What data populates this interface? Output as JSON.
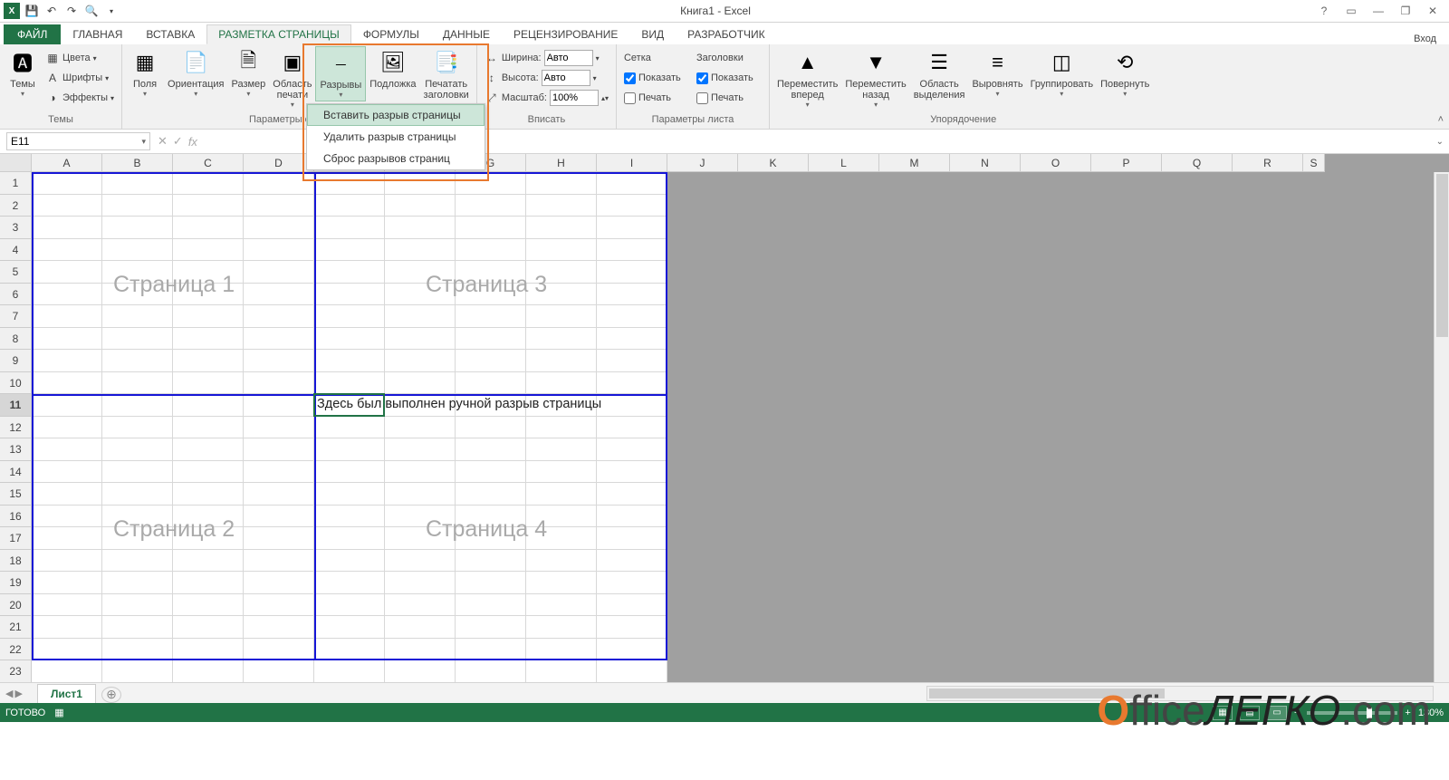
{
  "title": "Книга1 - Excel",
  "qat": {
    "save": "save",
    "undo": "undo",
    "redo": "redo",
    "preview": "preview"
  },
  "winctrl": {
    "help": "?",
    "opts": "▭",
    "min": "—",
    "max": "❐",
    "close": "✕"
  },
  "login": "Вход",
  "tabs": {
    "file": "ФАЙЛ",
    "home": "ГЛАВНАЯ",
    "insert": "ВСТАВКА",
    "layout": "РАЗМЕТКА СТРАНИЦЫ",
    "formulas": "ФОРМУЛЫ",
    "data": "ДАННЫЕ",
    "review": "РЕЦЕНЗИРОВАНИЕ",
    "view": "ВИД",
    "dev": "РАЗРАБОТЧИК"
  },
  "ribbon": {
    "themes": {
      "themes": "Темы",
      "colors": "Цвета",
      "fonts": "Шрифты",
      "effects": "Эффекты",
      "group": "Темы"
    },
    "pagesetup": {
      "margins": "Поля",
      "orient": "Ориентация",
      "size": "Размер",
      "printarea": "Область\nпечати",
      "breaks": "Разрывы",
      "background": "Подложка",
      "printtitles": "Печатать\nзаголовки",
      "group": "Параметры страницы"
    },
    "fit": {
      "widthl": "Ширина:",
      "widthv": "Авто",
      "heightl": "Высота:",
      "heightv": "Авто",
      "scalel": "Масштаб:",
      "scalev": "100%",
      "group": "Вписать"
    },
    "sheetopts": {
      "grid": "Сетка",
      "head": "Заголовки",
      "show": "Показать",
      "print": "Печать",
      "group": "Параметры листа"
    },
    "arrange": {
      "fwd": "Переместить\nвперед",
      "back": "Переместить\nназад",
      "sel": "Область\nвыделения",
      "align": "Выровнять",
      "group_btn": "Группировать",
      "rotate": "Повернуть",
      "group": "Упорядочение"
    }
  },
  "breaks_menu": {
    "insert": "Вставить разрыв страницы",
    "remove": "Удалить разрыв страницы",
    "reset": "Сброс разрывов страниц"
  },
  "namebox": "E11",
  "formula": "Здесь был выполнен ручной разрыв страницы",
  "formula_partial": "ыв страницы",
  "cols": [
    "A",
    "B",
    "C",
    "D",
    "E",
    "F",
    "G",
    "H",
    "I",
    "J",
    "K",
    "L",
    "M",
    "N",
    "O",
    "P",
    "Q",
    "R",
    "S"
  ],
  "rows": [
    "1",
    "2",
    "3",
    "4",
    "5",
    "6",
    "7",
    "8",
    "9",
    "10",
    "11",
    "12",
    "13",
    "14",
    "15",
    "16",
    "17",
    "18",
    "19",
    "20",
    "21",
    "22",
    "23"
  ],
  "page_wm": {
    "p1": "Страница 1",
    "p2": "Страница 2",
    "p3": "Страница 3",
    "p4": "Страница 4"
  },
  "celltext": "Здесь был выполнен ручной разрыв страницы",
  "sheettab": "Лист1",
  "status": {
    "ready": "ГОТОВО",
    "zoom": "130%"
  },
  "logo": {
    "a": "O",
    "b": "ffice",
    "c": "ЛЕГКО",
    "d": ".com"
  }
}
